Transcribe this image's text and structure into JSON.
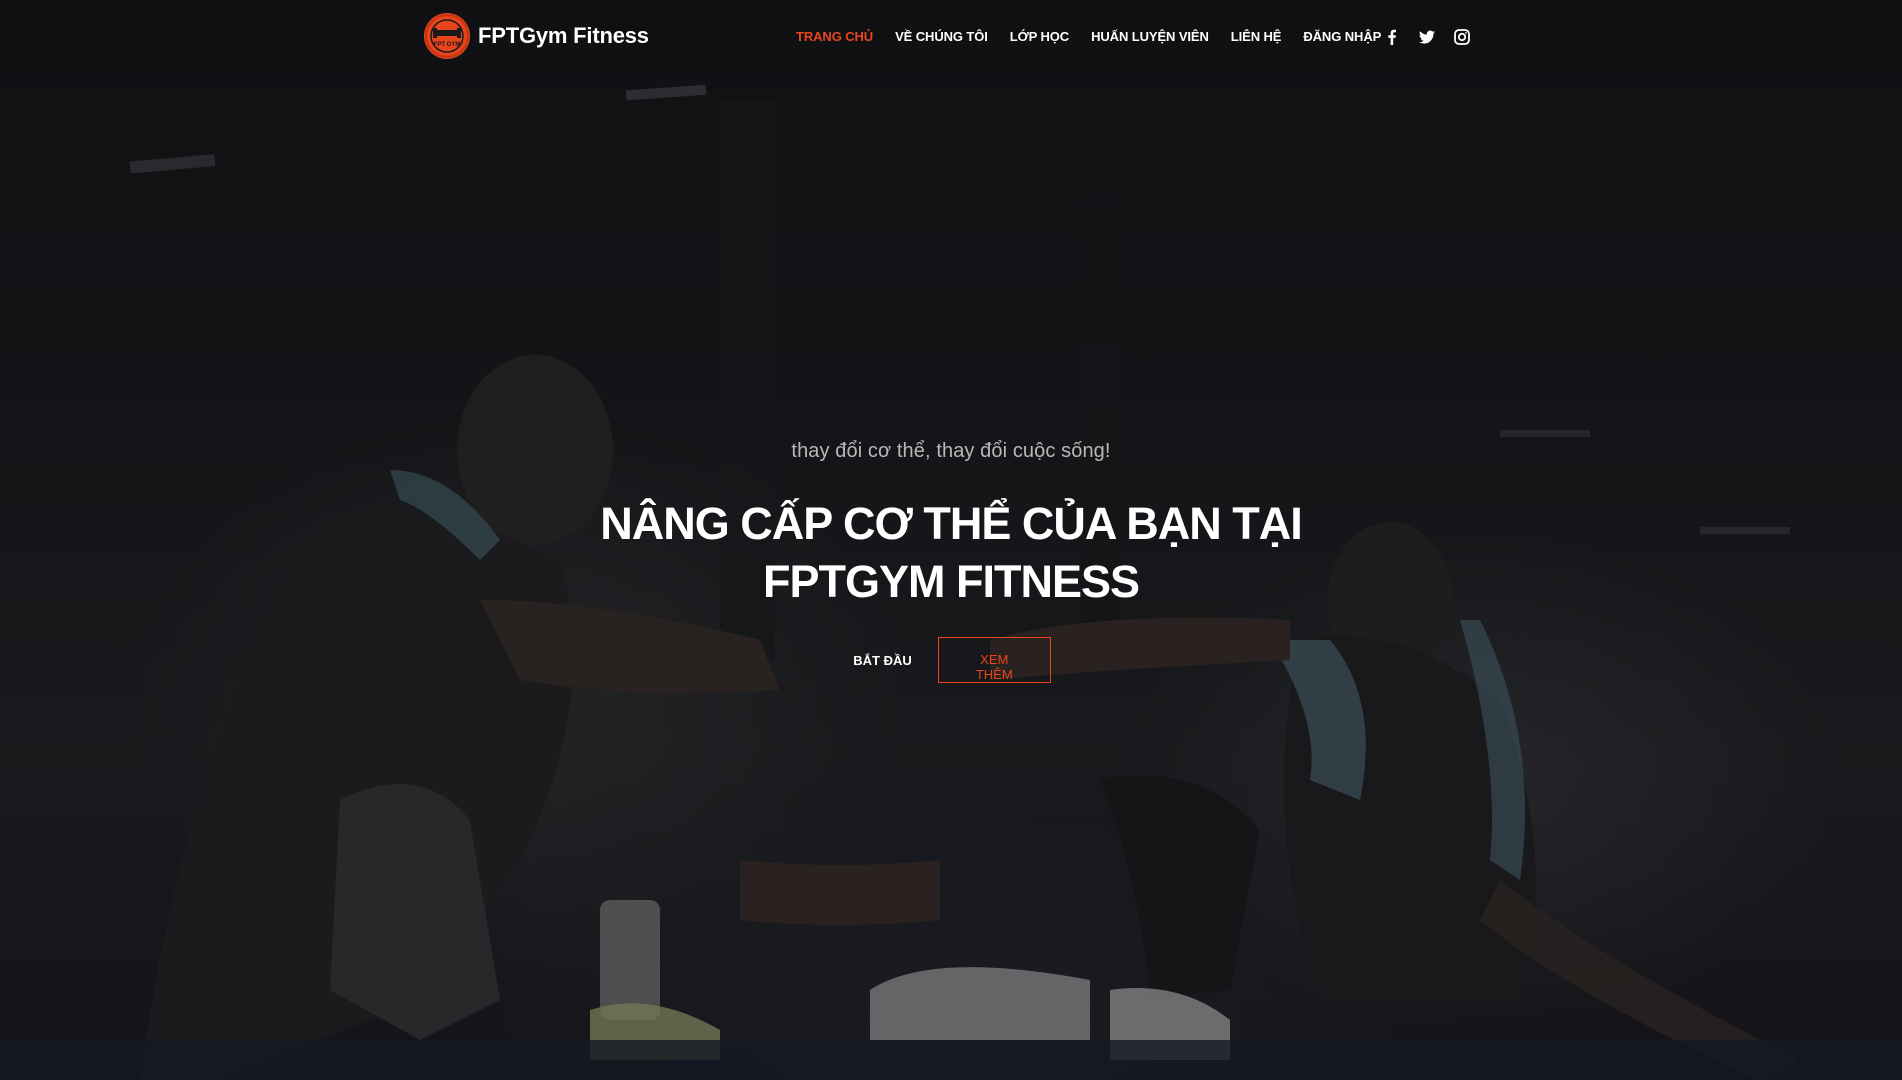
{
  "brand": {
    "name": "FPTGym Fitness",
    "logo_badge_text": "FPT GYM",
    "accent_color": "#e8451d"
  },
  "nav": {
    "items": [
      {
        "label": "TRANG CHỦ",
        "active": true
      },
      {
        "label": "VỀ CHÚNG TÔI",
        "active": false
      },
      {
        "label": "LỚP HỌC",
        "active": false
      },
      {
        "label": "HUẤN LUYỆN VIÊN",
        "active": false
      },
      {
        "label": "LIÊN HỆ",
        "active": false
      },
      {
        "label": "ĐĂNG NHẬP",
        "active": false
      }
    ],
    "social_icons": [
      "facebook-icon",
      "twitter-icon",
      "instagram-icon"
    ]
  },
  "hero": {
    "tagline": "thay đổi cơ thể, thay đổi cuộc sống!",
    "headline": "NÂNG CẤP CƠ THỂ CỦA BẠN TẠI FPTGYM FITNESS",
    "primary_button": "BẮT ĐẦU",
    "secondary_button": "XEM THÊM",
    "background_image": "two-people-sitting-on-gym-floor-fist-bump"
  }
}
